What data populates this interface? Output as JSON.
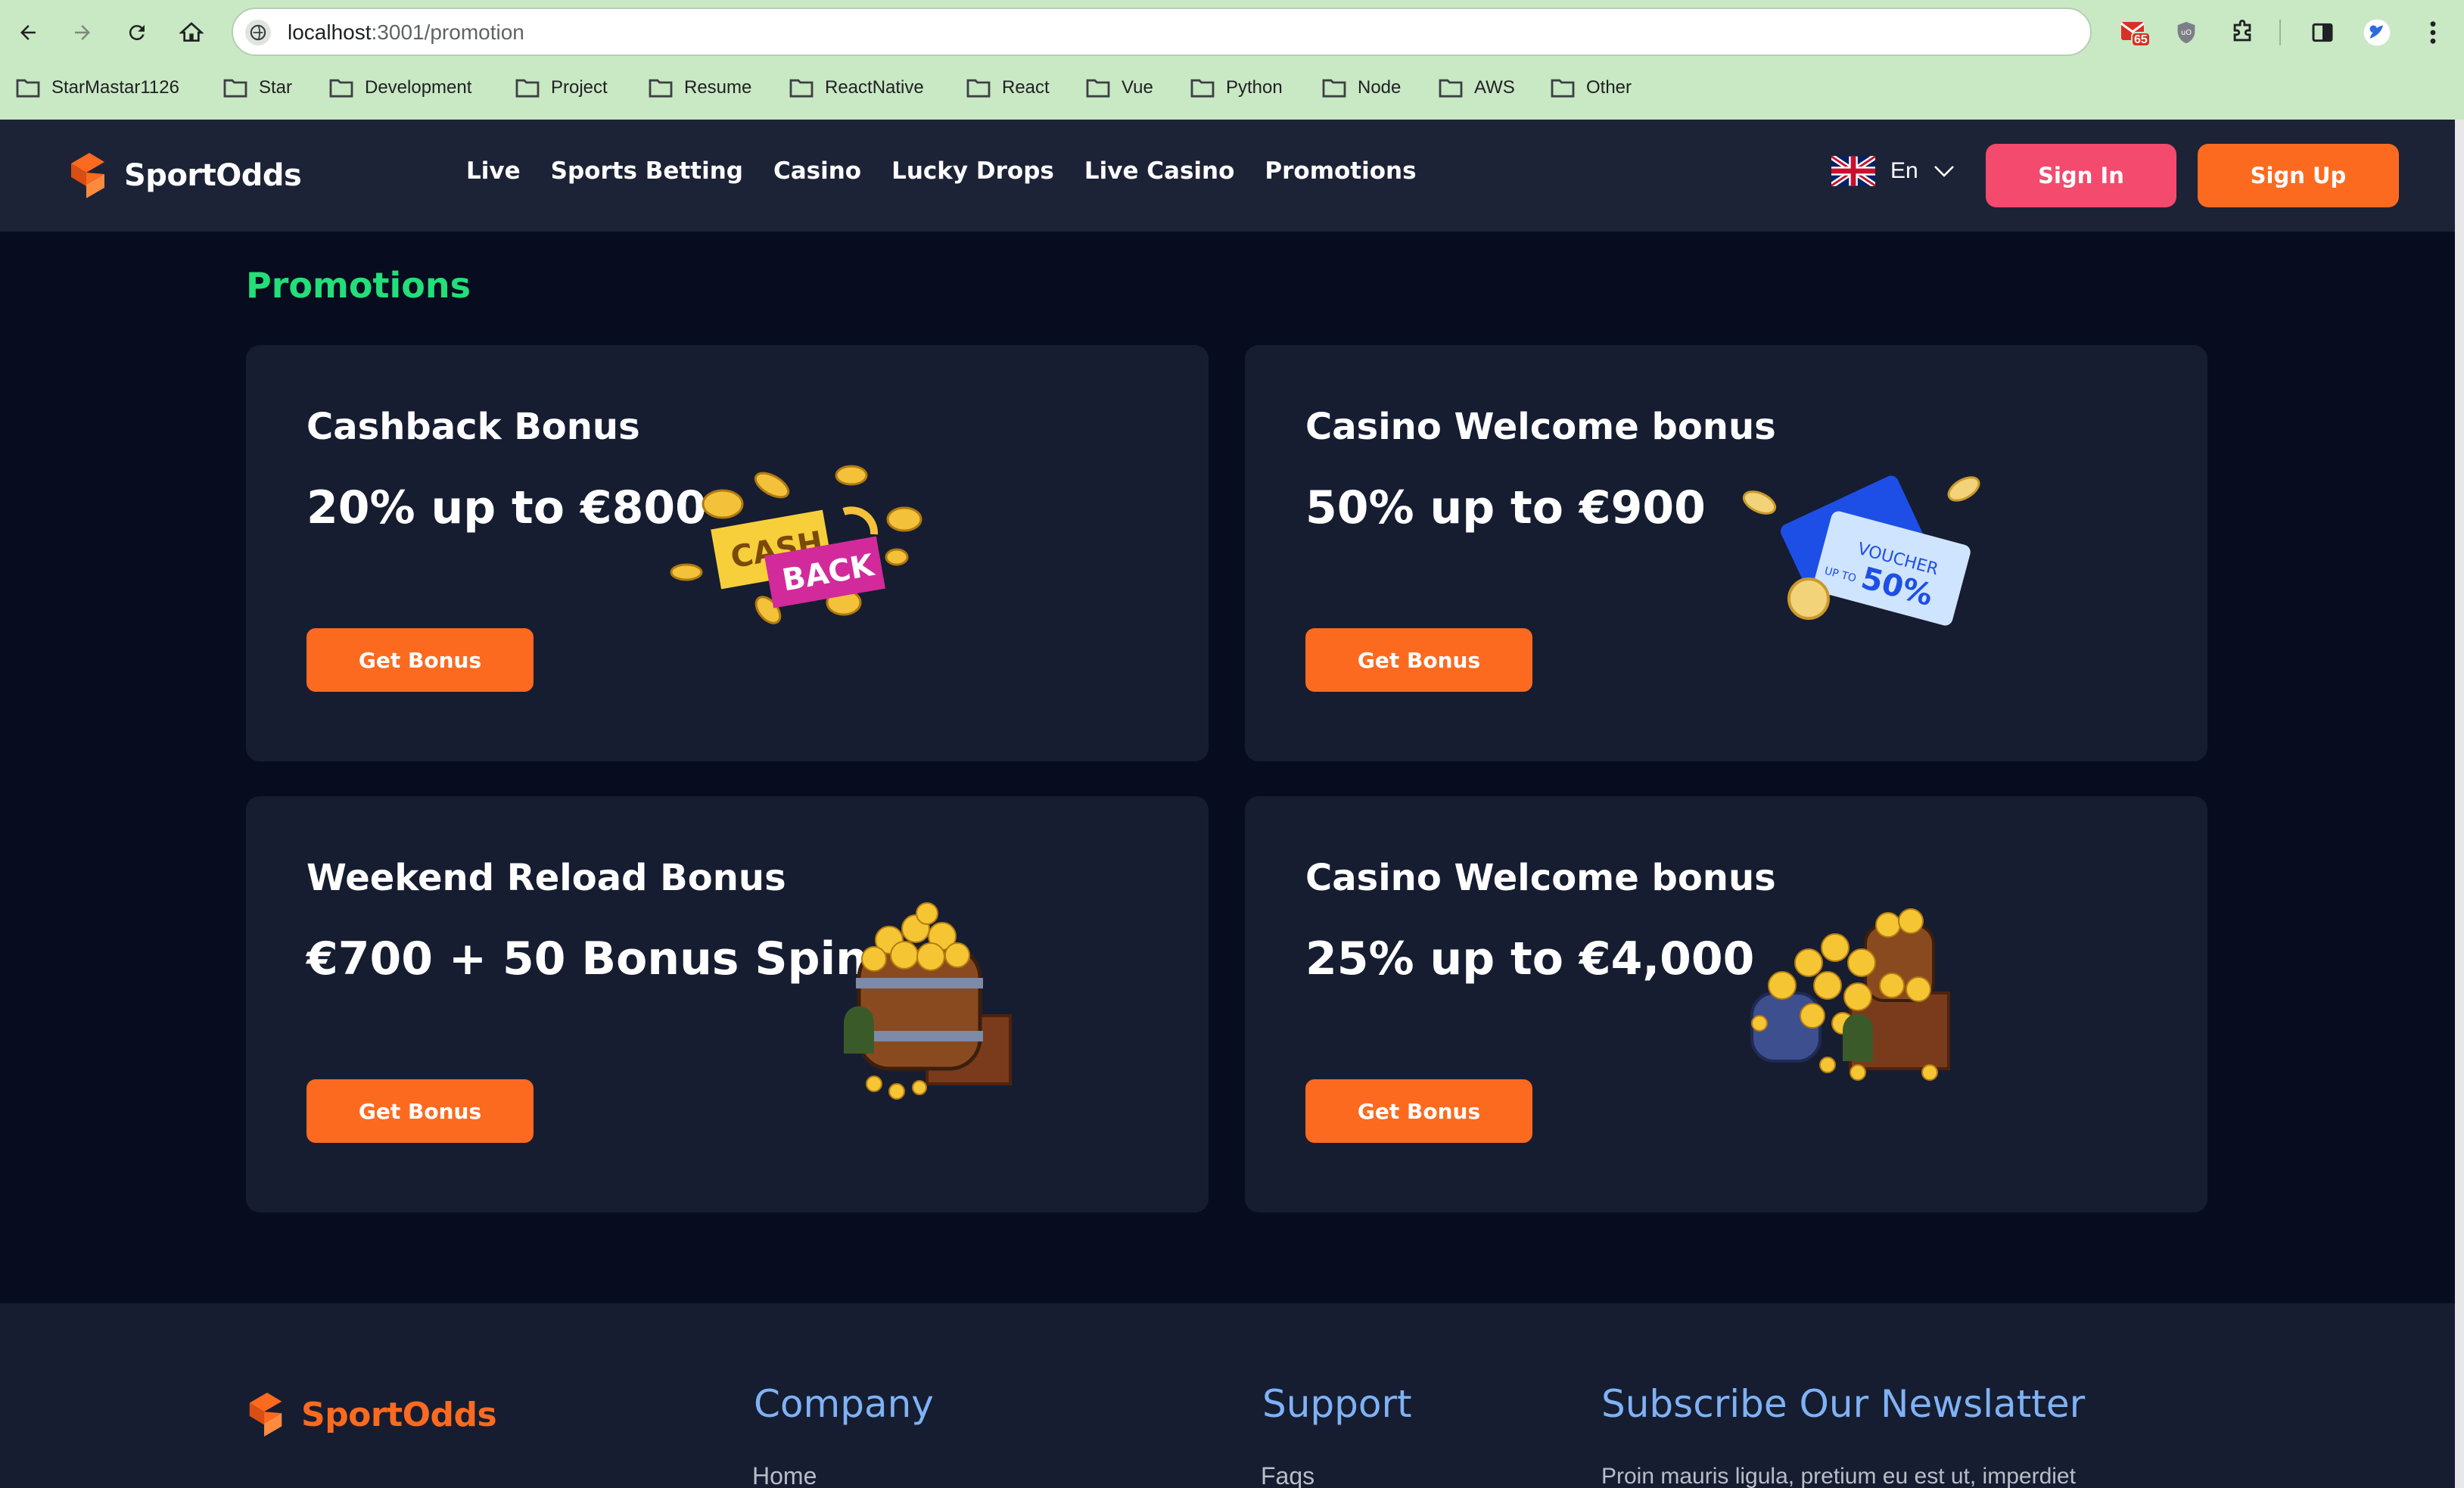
{
  "browser": {
    "url_host": "localhost",
    "url_path": ":3001/promotion",
    "extension_badge": "65",
    "bookmarks": [
      "StarMastar1126",
      "Star",
      "Development",
      "Project",
      "Resume",
      "ReactNative",
      "React",
      "Vue",
      "Python",
      "Node",
      "AWS",
      "Other"
    ]
  },
  "header": {
    "brand": "SportOdds",
    "nav": [
      "Live",
      "Sports Betting",
      "Casino",
      "Lucky Drops",
      "Live Casino",
      "Promotions"
    ],
    "language": "En",
    "sign_in": "Sign In",
    "sign_up": "Sign Up"
  },
  "main": {
    "heading": "Promotions",
    "cards": [
      {
        "title": "Cashback Bonus",
        "amount": "20% up to €800",
        "button": "Get Bonus",
        "art": "cashback-illustration",
        "art_text": [
          "CASH",
          "BACK"
        ]
      },
      {
        "title": "Casino Welcome bonus",
        "amount": "50% up to €900",
        "button": "Get Bonus",
        "art": "voucher-illustration",
        "art_text": [
          "VOUCHER",
          "UP TO",
          "50%"
        ]
      },
      {
        "title": "Weekend Reload Bonus",
        "amount": "€700 + 50 Bonus Spins",
        "button": "Get Bonus",
        "art": "treasure-barrel-illustration"
      },
      {
        "title": "Casino Welcome bonus",
        "amount": "25% up to €4,000",
        "button": "Get Bonus",
        "art": "treasure-pile-illustration"
      }
    ]
  },
  "footer": {
    "brand": "SportOdds",
    "company_heading": "Company",
    "company_link": "Home",
    "support_heading": "Support",
    "support_link": "Faqs",
    "newsletter_heading": "Subscribe Our Newslatter",
    "newsletter_text": "Proin mauris ligula, pretium eu est ut, imperdiet"
  },
  "colors": {
    "accent_orange": "#fc6a1f",
    "signin_pink": "#f34a6d",
    "promotions_green": "#22df79",
    "footer_heading_blue": "#7fb2f5",
    "card_bg": "#161d31",
    "page_bg": "#070c1e"
  }
}
